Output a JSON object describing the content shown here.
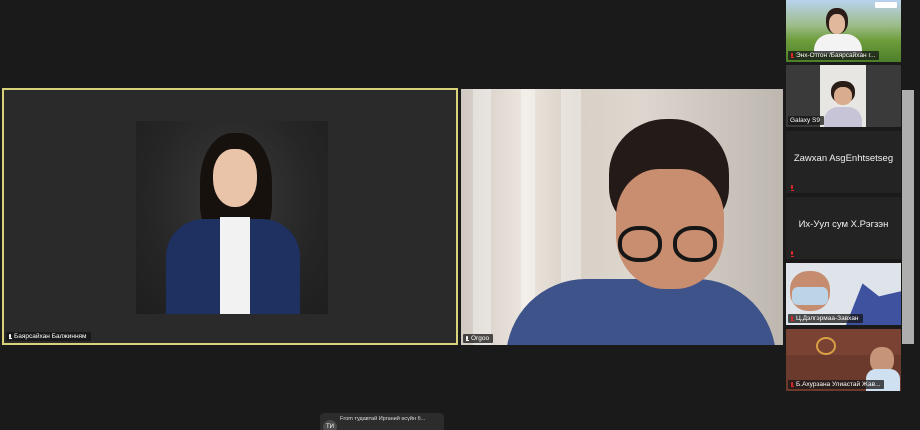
{
  "participants": {
    "main": {
      "name": "Баярсайхан Балжинням",
      "muted": false
    },
    "orgoo": {
      "name": "Orgoo",
      "muted": false
    },
    "enkh": {
      "name": "Энх-Отгон /Баярсайхан г...",
      "muted": true
    },
    "galaxy": {
      "name": "Galaxy S9",
      "muted": false
    },
    "zawxan": {
      "name": "Zawxan AsgEnhtsetseg",
      "muted": true
    },
    "ikh": {
      "name": "Их-Уул сум Х.Рэгзэн",
      "muted": true
    },
    "dulg": {
      "name": "Ц.Дэлгэрмаа-Завхан",
      "muted": true
    },
    "akhu": {
      "name": "Б.Ахурзана Улиастай Жав...",
      "muted": true
    }
  },
  "chat_toast": {
    "avatar_initials": "ТИ",
    "message": "From тудавтай Ирганий өсүйн б..."
  },
  "colors": {
    "active_speaker_border": "#d8d27a",
    "muted_mic": "#e02828",
    "background": "#1a1a1a"
  }
}
